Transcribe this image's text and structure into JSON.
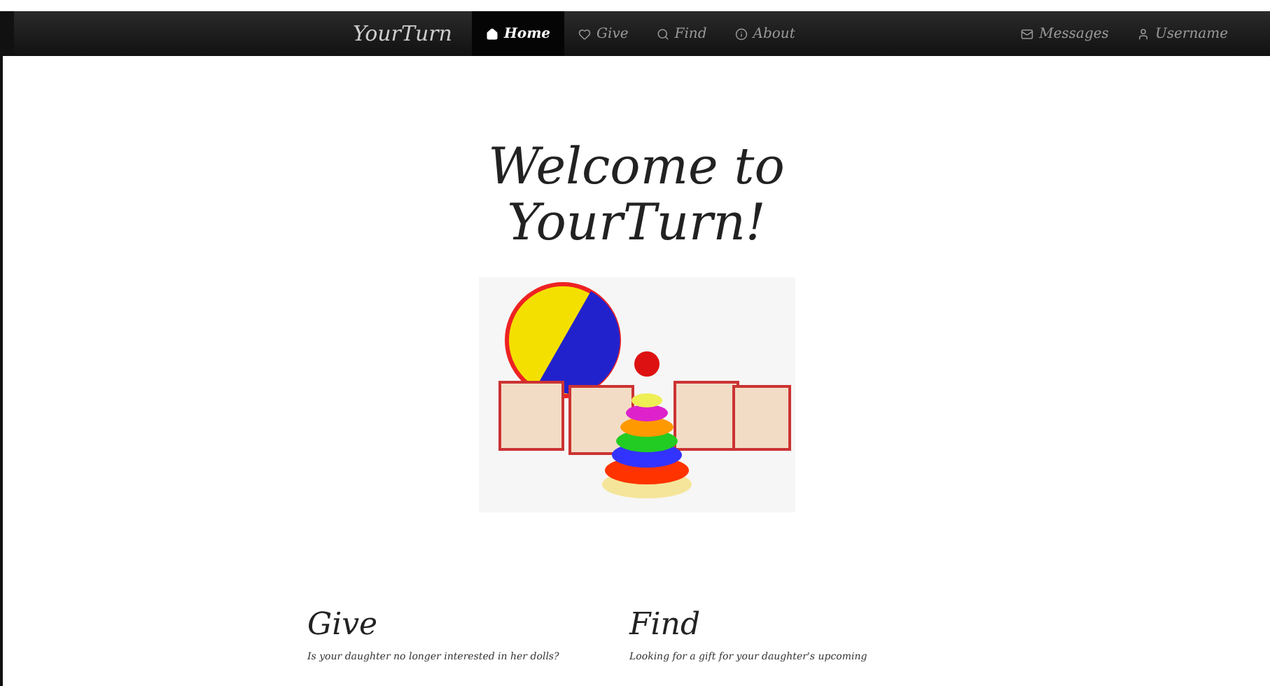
{
  "navbar": {
    "brand": "YourTurn",
    "items": [
      {
        "label": "Home",
        "kind": "home",
        "selected": true
      },
      {
        "label": "Give",
        "kind": "heart",
        "selected": false
      },
      {
        "label": "Find",
        "kind": "search",
        "selected": false
      },
      {
        "label": "About",
        "kind": "info",
        "selected": false
      }
    ],
    "right_items": [
      {
        "label": "Messages",
        "kind": "mail"
      },
      {
        "label": "Username",
        "kind": "user"
      }
    ]
  },
  "hero": {
    "title_lines": [
      "Welcome to",
      "YourTurn!"
    ]
  },
  "sections": [
    {
      "heading": "Give",
      "text": "Is your daughter no longer interested in her dolls?"
    },
    {
      "heading": "Find",
      "text": "Looking for a gift for your daughter's upcoming"
    }
  ]
}
